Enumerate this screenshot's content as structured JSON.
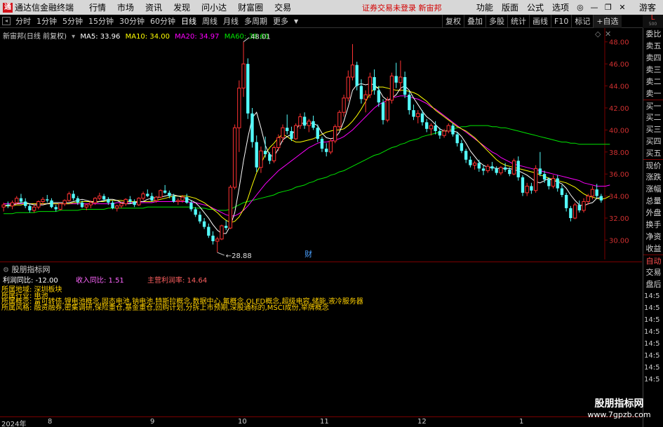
{
  "titlebar": {
    "logo": "通",
    "app_name": "通达信金融终端",
    "menu": [
      "行情",
      "市场",
      "资讯",
      "发现",
      "问小达",
      "财富圈",
      "交易"
    ],
    "notice": "证券交易未登录 新宙邦",
    "right_items": [
      "功能",
      "版面",
      "公式",
      "选项"
    ],
    "guest": "游客"
  },
  "toolbar": {
    "periods": [
      "分时",
      "1分钟",
      "5分钟",
      "15分钟",
      "30分钟",
      "60分钟",
      "日线",
      "周线",
      "月线",
      "多周期",
      "更多"
    ],
    "active_period": "日线",
    "buttons": [
      "复权",
      "叠加",
      "多股",
      "统计",
      "画线",
      "F10",
      "标记",
      "+自选"
    ]
  },
  "topright": {
    "big": "L",
    "small": "500"
  },
  "legend": {
    "stock": "新宙邦(日线 前复权)",
    "ma5": "MA5: 33.96",
    "ma10": "MA10: 34.00",
    "ma20": "MA20: 34.97",
    "ma60": "MA60: 38.68"
  },
  "colors": {
    "up": "#ff3232",
    "down": "#54fcfc",
    "ma5": "#ffffff",
    "ma10": "#ffff00",
    "ma20": "#ff00ff",
    "ma60": "#00e600"
  },
  "price_axis": [
    "48.00",
    "46.00",
    "44.00",
    "42.00",
    "40.00",
    "38.00",
    "36.00",
    "34.00",
    "32.00",
    "30.00"
  ],
  "annotations": {
    "high": "48.01",
    "low": "28.88",
    "marker": "财"
  },
  "indicator": {
    "title": "股朋指标网",
    "profit_label": "利润同比: -12.00",
    "revenue_label": "收入同比: 1.51",
    "margin_label": "主营利润率: 14.64",
    "f1": "所属地域: 深圳板块",
    "f2": "所属行业: 电池",
    "f3": "所属概念: 富可转债,锂电池概念,固态电池,钠电池,特斯拉概念,数据中心,氟概念,OLED概念,超级电容,储能,液冷服务器",
    "f4": "所属风格: 融资融券,密集调研,保险重仓,基金重仓,回购计划,分拆上市预期,深股通标的,MSCI成份,举牌概念"
  },
  "sidebar_items": [
    "委比",
    "卖五",
    "卖四",
    "卖三",
    "卖二",
    "卖一",
    "买一",
    "买二",
    "买三",
    "买四",
    "买五",
    "现价",
    "涨跌",
    "涨幅",
    "总量",
    "外盘",
    "换手",
    "净资",
    "收益",
    "自动",
    "交易",
    "盘后"
  ],
  "sidebar_times": [
    "14:5",
    "14:5",
    "14:5",
    "14:5",
    "14:5",
    "14:5",
    "14:5",
    "14:5"
  ],
  "date_axis": [
    {
      "t": "2024年",
      "x": 2
    },
    {
      "t": "8",
      "x": 68
    },
    {
      "t": "9",
      "x": 214
    },
    {
      "t": "10",
      "x": 339
    },
    {
      "t": "11",
      "x": 456
    },
    {
      "t": "12",
      "x": 595
    },
    {
      "t": "1",
      "x": 740
    }
  ],
  "watermark": {
    "line1": "股朋指标网",
    "line2": "www.7gpzb.com"
  },
  "chart_data": {
    "type": "candlestick",
    "ylim": [
      28.5,
      49
    ],
    "candles": [
      [
        33.0,
        33.4,
        32.6,
        33.2
      ],
      [
        33.2,
        33.5,
        32.9,
        33.1
      ],
      [
        33.1,
        33.6,
        32.8,
        33.4
      ],
      [
        33.4,
        34.0,
        33.2,
        33.8
      ],
      [
        33.8,
        34.2,
        33.3,
        33.5
      ],
      [
        33.5,
        33.8,
        32.9,
        33.1
      ],
      [
        33.1,
        33.3,
        32.5,
        32.7
      ],
      [
        32.7,
        33.2,
        32.5,
        33.0
      ],
      [
        33.0,
        33.6,
        32.8,
        33.5
      ],
      [
        33.5,
        33.9,
        33.2,
        33.7
      ],
      [
        33.7,
        34.1,
        33.4,
        33.6
      ],
      [
        33.6,
        33.8,
        32.9,
        33.0
      ],
      [
        33.0,
        33.2,
        32.6,
        32.8
      ],
      [
        32.8,
        33.4,
        32.7,
        33.3
      ],
      [
        33.3,
        33.7,
        33.1,
        33.6
      ],
      [
        33.6,
        34.4,
        33.5,
        34.2
      ],
      [
        34.2,
        34.5,
        33.6,
        33.8
      ],
      [
        33.8,
        34.0,
        33.2,
        33.4
      ],
      [
        33.4,
        33.6,
        32.9,
        33.0
      ],
      [
        33.0,
        33.3,
        32.7,
        33.2
      ],
      [
        33.2,
        33.6,
        32.9,
        33.4
      ],
      [
        33.4,
        33.9,
        33.2,
        33.8
      ],
      [
        33.8,
        34.3,
        33.6,
        34.0
      ],
      [
        34.0,
        34.2,
        33.5,
        33.7
      ],
      [
        33.7,
        33.9,
        33.2,
        33.4
      ],
      [
        33.4,
        33.6,
        32.8,
        32.9
      ],
      [
        32.9,
        33.2,
        32.6,
        33.1
      ],
      [
        33.1,
        33.5,
        32.9,
        33.3
      ],
      [
        33.3,
        33.8,
        33.1,
        33.7
      ],
      [
        33.7,
        34.0,
        33.3,
        33.5
      ],
      [
        33.5,
        33.7,
        33.0,
        33.2
      ],
      [
        33.2,
        33.9,
        33.1,
        33.8
      ],
      [
        33.8,
        34.4,
        33.6,
        34.2
      ],
      [
        34.2,
        34.6,
        33.9,
        34.0
      ],
      [
        34.0,
        34.3,
        33.5,
        33.6
      ],
      [
        33.6,
        34.0,
        33.4,
        33.9
      ],
      [
        33.9,
        34.6,
        33.8,
        34.5
      ],
      [
        34.5,
        35.0,
        34.2,
        34.3
      ],
      [
        34.3,
        34.5,
        33.8,
        34.0
      ],
      [
        34.0,
        34.2,
        33.4,
        33.5
      ],
      [
        33.5,
        33.8,
        33.2,
        33.6
      ],
      [
        33.6,
        34.1,
        33.4,
        33.9
      ],
      [
        33.9,
        34.2,
        33.3,
        33.4
      ],
      [
        33.4,
        33.6,
        32.6,
        32.8
      ],
      [
        32.8,
        33.0,
        32.1,
        32.3
      ],
      [
        32.3,
        32.6,
        31.5,
        31.7
      ],
      [
        31.7,
        32.0,
        31.0,
        31.2
      ],
      [
        31.2,
        31.5,
        30.2,
        30.4
      ],
      [
        30.4,
        30.8,
        29.6,
        29.9
      ],
      [
        29.9,
        30.3,
        28.88,
        30.1
      ],
      [
        30.1,
        31.4,
        30.0,
        31.3
      ],
      [
        31.3,
        31.8,
        30.9,
        31.1
      ],
      [
        31.1,
        35.0,
        31.0,
        34.8
      ],
      [
        34.8,
        40.5,
        34.6,
        40.2
      ],
      [
        40.2,
        44.5,
        38.0,
        43.8
      ],
      [
        43.8,
        48.01,
        43.0,
        46.0
      ],
      [
        46.0,
        46.5,
        41.0,
        41.5
      ],
      [
        41.5,
        42.0,
        38.4,
        38.9
      ],
      [
        38.9,
        39.5,
        36.2,
        36.6
      ],
      [
        36.6,
        38.5,
        36.1,
        38.1
      ],
      [
        38.1,
        39.4,
        37.5,
        37.8
      ],
      [
        37.8,
        38.0,
        36.9,
        37.2
      ],
      [
        37.2,
        38.6,
        37.0,
        38.4
      ],
      [
        38.4,
        39.6,
        38.1,
        39.3
      ],
      [
        39.3,
        40.5,
        38.9,
        40.2
      ],
      [
        40.2,
        41.4,
        39.6,
        39.9
      ],
      [
        39.9,
        40.3,
        39.0,
        39.2
      ],
      [
        39.2,
        40.6,
        39.1,
        40.4
      ],
      [
        40.4,
        41.5,
        40.1,
        41.2
      ],
      [
        41.2,
        41.6,
        40.1,
        40.4
      ],
      [
        40.4,
        41.0,
        39.8,
        40.8
      ],
      [
        40.8,
        41.3,
        40.0,
        40.2
      ],
      [
        40.2,
        40.5,
        38.9,
        39.2
      ],
      [
        39.2,
        39.4,
        38.0,
        38.3
      ],
      [
        38.3,
        38.8,
        37.6,
        38.0
      ],
      [
        38.0,
        39.2,
        37.8,
        39.0
      ],
      [
        39.0,
        40.5,
        38.8,
        40.3
      ],
      [
        40.3,
        41.8,
        40.0,
        41.6
      ],
      [
        41.6,
        43.2,
        41.2,
        42.9
      ],
      [
        42.9,
        45.4,
        42.6,
        44.8
      ],
      [
        44.8,
        47.8,
        44.5,
        45.9
      ],
      [
        45.9,
        46.2,
        43.6,
        44.0
      ],
      [
        44.0,
        44.6,
        42.4,
        42.8
      ],
      [
        42.8,
        43.6,
        41.6,
        43.2
      ],
      [
        43.2,
        45.2,
        42.9,
        44.8
      ],
      [
        44.8,
        45.5,
        43.2,
        43.6
      ],
      [
        43.6,
        44.0,
        42.1,
        42.5
      ],
      [
        42.5,
        42.8,
        40.5,
        40.9
      ],
      [
        40.9,
        43.0,
        40.7,
        42.7
      ],
      [
        42.7,
        45.2,
        42.4,
        44.9
      ],
      [
        44.9,
        46.1,
        43.8,
        44.3
      ],
      [
        44.3,
        46.3,
        43.5,
        44.8
      ],
      [
        44.8,
        45.3,
        42.9,
        43.2
      ],
      [
        43.2,
        43.5,
        41.4,
        41.8
      ],
      [
        41.8,
        42.3,
        40.9,
        41.2
      ],
      [
        41.2,
        41.8,
        40.6,
        41.5
      ],
      [
        41.5,
        41.8,
        40.4,
        40.7
      ],
      [
        40.7,
        41.0,
        39.8,
        40.1
      ],
      [
        40.1,
        40.6,
        39.5,
        40.4
      ],
      [
        40.4,
        40.8,
        39.6,
        39.9
      ],
      [
        39.9,
        40.2,
        39.2,
        39.5
      ],
      [
        39.5,
        40.1,
        39.3,
        39.9
      ],
      [
        39.9,
        40.6,
        39.7,
        40.4
      ],
      [
        40.4,
        40.6,
        39.4,
        39.6
      ],
      [
        39.6,
        39.8,
        38.5,
        38.8
      ],
      [
        38.8,
        39.1,
        37.9,
        38.1
      ],
      [
        38.1,
        38.3,
        37.0,
        37.3
      ],
      [
        37.3,
        37.6,
        36.6,
        36.8
      ],
      [
        36.8,
        37.2,
        36.4,
        37.0
      ],
      [
        37.0,
        37.3,
        36.2,
        36.5
      ],
      [
        36.5,
        36.8,
        35.9,
        36.3
      ],
      [
        36.3,
        36.9,
        36.1,
        36.7
      ],
      [
        36.7,
        37.1,
        36.3,
        36.5
      ],
      [
        36.5,
        36.7,
        35.9,
        36.1
      ],
      [
        36.1,
        36.7,
        35.9,
        36.6
      ],
      [
        36.6,
        37.0,
        36.2,
        36.4
      ],
      [
        36.4,
        36.6,
        35.8,
        36.0
      ],
      [
        36.0,
        37.4,
        35.9,
        37.2
      ],
      [
        37.2,
        37.6,
        35.4,
        35.7
      ],
      [
        35.7,
        35.9,
        34.0,
        34.3
      ],
      [
        34.3,
        35.2,
        34.0,
        34.9
      ],
      [
        34.9,
        35.2,
        34.2,
        34.5
      ],
      [
        34.5,
        36.8,
        34.3,
        36.5
      ],
      [
        36.5,
        38.0,
        35.8,
        36.0
      ],
      [
        36.0,
        36.3,
        35.2,
        35.5
      ],
      [
        35.5,
        35.7,
        34.6,
        34.9
      ],
      [
        34.9,
        35.9,
        34.7,
        35.6
      ],
      [
        35.6,
        35.9,
        34.4,
        34.7
      ],
      [
        34.7,
        35.0,
        33.9,
        34.1
      ],
      [
        34.1,
        34.3,
        32.6,
        32.9
      ],
      [
        32.9,
        33.1,
        31.7,
        32.0
      ],
      [
        32.0,
        33.4,
        31.9,
        33.2
      ],
      [
        33.2,
        33.6,
        32.5,
        32.7
      ],
      [
        32.7,
        33.8,
        32.5,
        33.5
      ],
      [
        33.5,
        34.2,
        33.2,
        34.0
      ],
      [
        34.0,
        34.9,
        33.7,
        34.6
      ],
      [
        34.6,
        35.1,
        33.8,
        34.0
      ],
      [
        34.0,
        34.2,
        33.4,
        33.6
      ]
    ],
    "ma5": [
      33.1,
      33.2,
      33.2,
      33.3,
      33.4,
      33.4,
      33.3,
      33.2,
      33.2,
      33.2,
      33.3,
      33.4,
      33.4,
      33.4,
      33.4,
      33.4,
      33.5,
      33.6,
      33.7,
      33.6,
      33.5,
      33.4,
      33.5,
      33.6,
      33.7,
      33.7,
      33.6,
      33.4,
      33.3,
      33.3,
      33.4,
      33.5,
      33.5,
      33.7,
      33.8,
      33.9,
      33.9,
      34.0,
      34.1,
      34.1,
      34.0,
      33.9,
      33.8,
      33.6,
      33.4,
      33.0,
      32.5,
      32.0,
      31.4,
      30.9,
      30.6,
      30.6,
      31.3,
      32.5,
      34.7,
      37.2,
      39.3,
      41.1,
      41.6,
      40.2,
      38.6,
      37.7,
      37.6,
      38.3,
      39.1,
      39.4,
      39.6,
      40.0,
      40.6,
      40.6,
      40.6,
      40.6,
      40.4,
      39.7,
      39.3,
      39.2,
      39.3,
      39.8,
      40.8,
      42.1,
      43.6,
      44.1,
      44.2,
      44.1,
      44.2,
      44.1,
      43.7,
      43.0,
      42.7,
      42.9,
      43.2,
      43.8,
      44.0,
      43.6,
      42.9,
      42.3,
      41.7,
      41.2,
      40.9,
      40.5,
      40.1,
      39.9,
      39.9,
      39.9,
      39.8,
      39.4,
      38.8,
      38.1,
      37.6,
      37.1,
      36.8,
      36.6,
      36.6,
      36.5,
      36.5,
      36.5,
      36.5,
      36.4,
      36.3,
      36.1,
      35.9,
      35.6,
      35.3,
      35.2,
      35.4,
      35.6,
      35.4,
      35.3,
      35.1,
      34.7,
      34.1,
      33.6,
      33.2,
      33.1,
      33.3,
      33.4,
      33.8,
      33.9
    ],
    "ma10": [
      33.1,
      33.1,
      33.1,
      33.2,
      33.2,
      33.3,
      33.3,
      33.3,
      33.3,
      33.3,
      33.3,
      33.3,
      33.3,
      33.3,
      33.3,
      33.3,
      33.4,
      33.4,
      33.5,
      33.5,
      33.5,
      33.5,
      33.5,
      33.5,
      33.6,
      33.6,
      33.6,
      33.6,
      33.5,
      33.5,
      33.5,
      33.5,
      33.5,
      33.5,
      33.5,
      33.6,
      33.7,
      33.8,
      33.9,
      34.0,
      34.0,
      34.0,
      34.0,
      33.9,
      33.8,
      33.6,
      33.4,
      33.1,
      32.8,
      32.5,
      32.1,
      31.8,
      31.6,
      31.7,
      32.1,
      32.8,
      33.8,
      35.0,
      36.1,
      36.9,
      37.8,
      38.4,
      38.8,
      39.3,
      39.6,
      39.4,
      39.1,
      38.9,
      38.9,
      39.0,
      39.1,
      39.2,
      39.4,
      39.6,
      39.8,
      39.9,
      40.0,
      40.0,
      40.1,
      40.4,
      40.8,
      41.3,
      41.9,
      42.6,
      43.3,
      43.8,
      43.9,
      43.9,
      43.8,
      43.7,
      43.6,
      43.6,
      43.6,
      43.5,
      43.4,
      43.2,
      42.9,
      42.6,
      42.2,
      41.8,
      41.5,
      41.2,
      40.9,
      40.6,
      40.3,
      40.1,
      39.9,
      39.6,
      39.3,
      38.9,
      38.5,
      38.1,
      37.7,
      37.3,
      37.0,
      36.8,
      36.7,
      36.6,
      36.5,
      36.4,
      36.3,
      36.2,
      36.1,
      35.9,
      35.8,
      35.6,
      35.5,
      35.4,
      35.3,
      35.2,
      35.0,
      34.8,
      34.5,
      34.2,
      34.0,
      33.9,
      33.8,
      33.7,
      33.8,
      34.0
    ],
    "ma20": [
      33.3,
      33.3,
      33.3,
      33.3,
      33.3,
      33.3,
      33.3,
      33.3,
      33.3,
      33.3,
      33.3,
      33.3,
      33.3,
      33.3,
      33.3,
      33.3,
      33.3,
      33.3,
      33.3,
      33.3,
      33.3,
      33.3,
      33.3,
      33.3,
      33.3,
      33.3,
      33.4,
      33.4,
      33.4,
      33.4,
      33.4,
      33.4,
      33.4,
      33.4,
      33.4,
      33.5,
      33.5,
      33.5,
      33.5,
      33.5,
      33.5,
      33.5,
      33.5,
      33.4,
      33.4,
      33.3,
      33.2,
      33.1,
      32.9,
      32.7,
      32.5,
      32.3,
      32.2,
      32.2,
      32.4,
      32.7,
      33.1,
      33.6,
      34.1,
      34.6,
      35.1,
      35.5,
      35.9,
      36.3,
      36.6,
      36.9,
      37.2,
      37.5,
      37.8,
      38.1,
      38.4,
      38.6,
      38.8,
      38.9,
      38.9,
      39.0,
      39.1,
      39.2,
      39.4,
      39.7,
      40.0,
      40.4,
      40.8,
      41.2,
      41.6,
      42.0,
      42.3,
      42.5,
      42.7,
      42.9,
      43.0,
      43.1,
      43.1,
      43.0,
      42.9,
      42.8,
      42.6,
      42.4,
      42.1,
      41.9,
      41.6,
      41.3,
      41.0,
      40.7,
      40.4,
      40.1,
      39.8,
      39.5,
      39.2,
      38.9,
      38.6,
      38.3,
      38.0,
      37.8,
      37.5,
      37.3,
      37.1,
      36.9,
      36.8,
      36.7,
      36.6,
      36.5,
      36.4,
      36.3,
      36.2,
      36.1,
      36.0,
      35.9,
      35.8,
      35.7,
      35.6,
      35.5,
      35.4,
      35.2,
      35.1,
      35.0,
      34.9,
      34.9,
      34.9,
      35.0
    ],
    "ma60": [
      32.4,
      32.4,
      32.4,
      32.5,
      32.5,
      32.5,
      32.5,
      32.5,
      32.6,
      32.6,
      32.6,
      32.6,
      32.6,
      32.7,
      32.7,
      32.7,
      32.7,
      32.7,
      32.8,
      32.8,
      32.8,
      32.8,
      32.8,
      32.8,
      32.9,
      32.9,
      32.9,
      32.9,
      32.9,
      32.9,
      32.9,
      32.9,
      32.9,
      33.0,
      33.0,
      33.0,
      33.0,
      33.0,
      33.0,
      33.0,
      33.0,
      33.0,
      33.0,
      33.0,
      32.9,
      32.9,
      32.9,
      32.8,
      32.8,
      32.7,
      32.7,
      32.7,
      32.8,
      33.0,
      33.2,
      33.4,
      33.5,
      33.6,
      33.7,
      33.8,
      33.9,
      34.0,
      34.1,
      34.3,
      34.4,
      34.5,
      34.6,
      34.8,
      34.9,
      35.0,
      35.2,
      35.3,
      35.5,
      35.6,
      35.7,
      35.9,
      36.0,
      36.2,
      36.3,
      36.5,
      36.7,
      36.9,
      37.1,
      37.3,
      37.5,
      37.7,
      37.8,
      38.0,
      38.2,
      38.4,
      38.5,
      38.7,
      38.8,
      39.0,
      39.1,
      39.2,
      39.4,
      39.5,
      39.6,
      39.7,
      39.8,
      39.9,
      40.0,
      40.1,
      40.2,
      40.3,
      40.3,
      40.4,
      40.4,
      40.4,
      40.4,
      40.4,
      40.3,
      40.3,
      40.2,
      40.2,
      40.1,
      40.0,
      39.9,
      39.8,
      39.7,
      39.6,
      39.5,
      39.4,
      39.3,
      39.2,
      39.1,
      39.0,
      38.9,
      38.9,
      38.8,
      38.8,
      38.7,
      38.7,
      38.7,
      38.7,
      38.7,
      38.7,
      38.7,
      38.7
    ]
  }
}
